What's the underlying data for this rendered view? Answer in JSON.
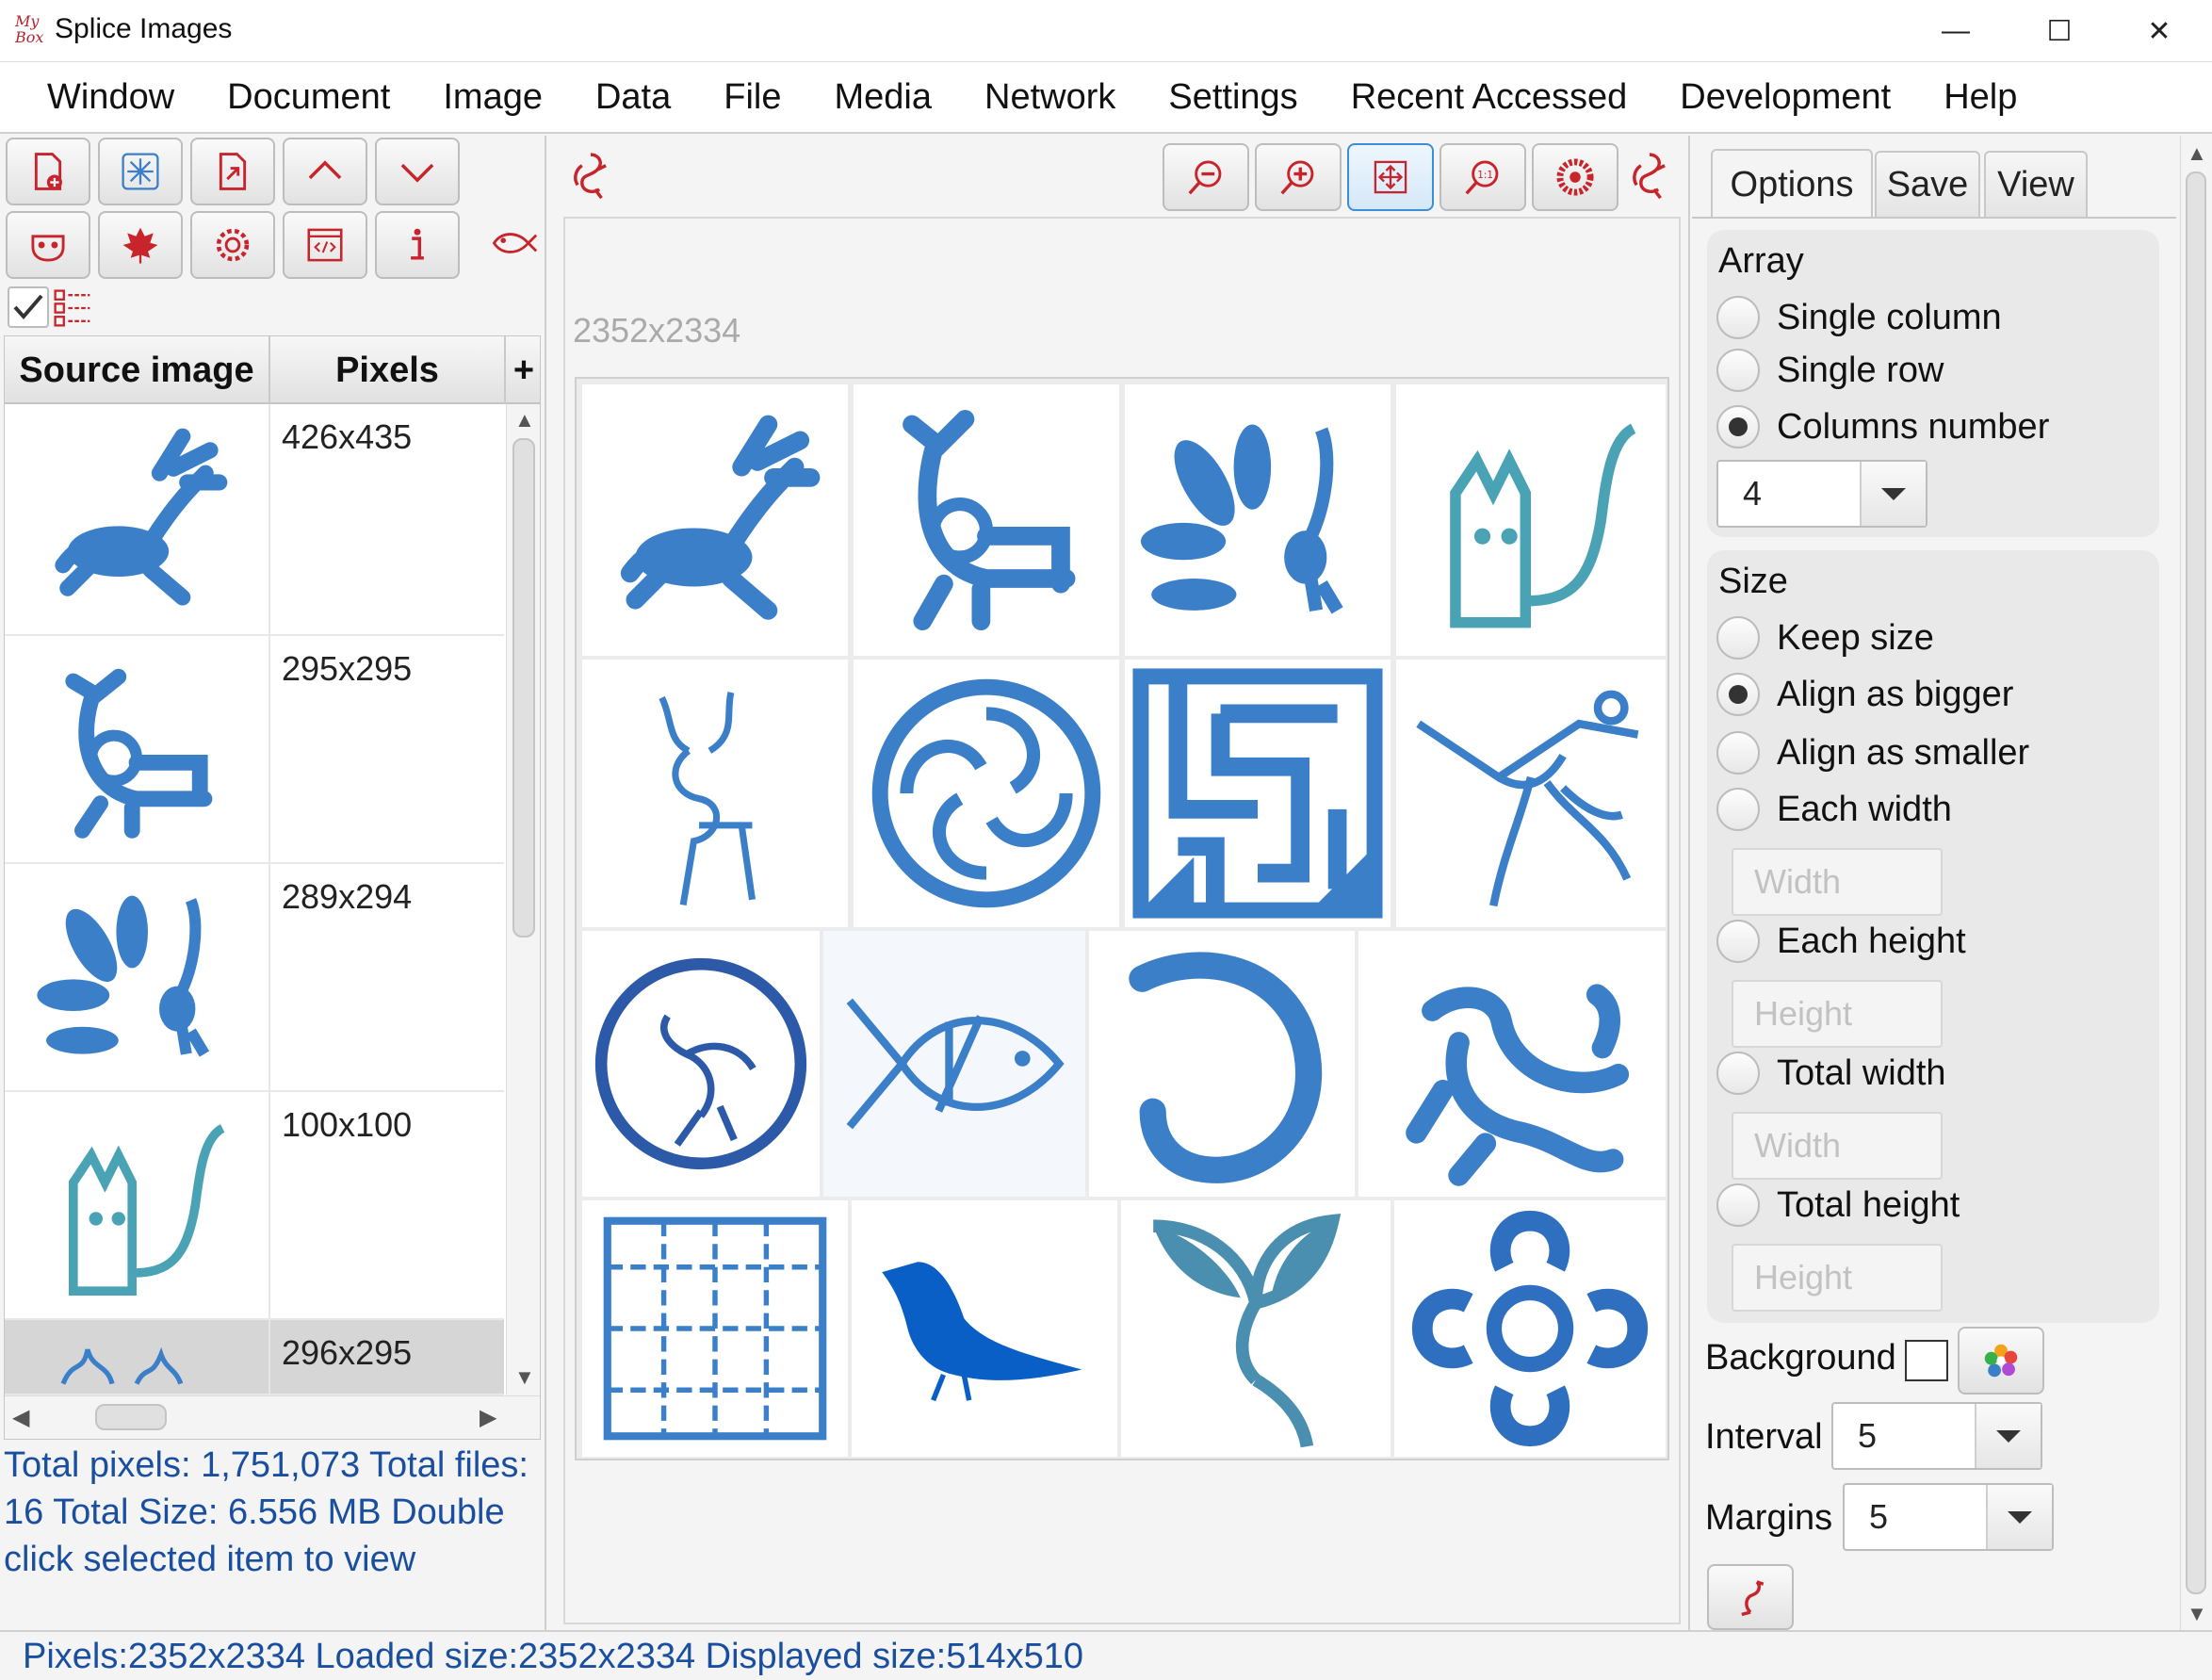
{
  "window": {
    "title": "Splice Images",
    "logo_text": "My Box",
    "controls": [
      "—",
      "☐",
      "✕"
    ]
  },
  "menu": [
    "Window",
    "Document",
    "Image",
    "Data",
    "File",
    "Media",
    "Network",
    "Settings",
    "Recent Accessed",
    "Development",
    "Help"
  ],
  "table": {
    "columns": [
      "Source image",
      "Pixels",
      "+"
    ],
    "rows": [
      {
        "pixels": "426x435"
      },
      {
        "pixels": "295x295"
      },
      {
        "pixels": "289x294"
      },
      {
        "pixels": "100x100"
      },
      {
        "pixels": "296x295"
      }
    ]
  },
  "left_status": "Total pixels: 1,751,073  Total files: 16  Total Size: 6.556 MB Double click selected item to view",
  "center": {
    "dimensions": "2352x2334"
  },
  "tabs": [
    "Options",
    "Save",
    "View"
  ],
  "array": {
    "title": "Array",
    "options": [
      "Single column",
      "Single row",
      "Columns number"
    ],
    "selected": "Columns number",
    "columns_value": "4"
  },
  "size": {
    "title": "Size",
    "options": [
      "Keep size",
      "Align as bigger",
      "Align as smaller",
      "Each width",
      "Each height",
      "Total width",
      "Total height"
    ],
    "selected": "Align as bigger",
    "placeholders": {
      "each_width": "Width",
      "each_height": "Height",
      "total_width": "Width",
      "total_height": "Height"
    }
  },
  "background_label": "Background",
  "interval": {
    "label": "Interval",
    "value": "5"
  },
  "margins": {
    "label": "Margins",
    "value": "5"
  },
  "status_bar": "Pixels:2352x2334  Loaded size:2352x2334  Displayed size:514x510",
  "colors": {
    "accent_red": "#c8242c",
    "image_blue": "#3c7fc9",
    "status_blue": "#1a4fa0"
  }
}
